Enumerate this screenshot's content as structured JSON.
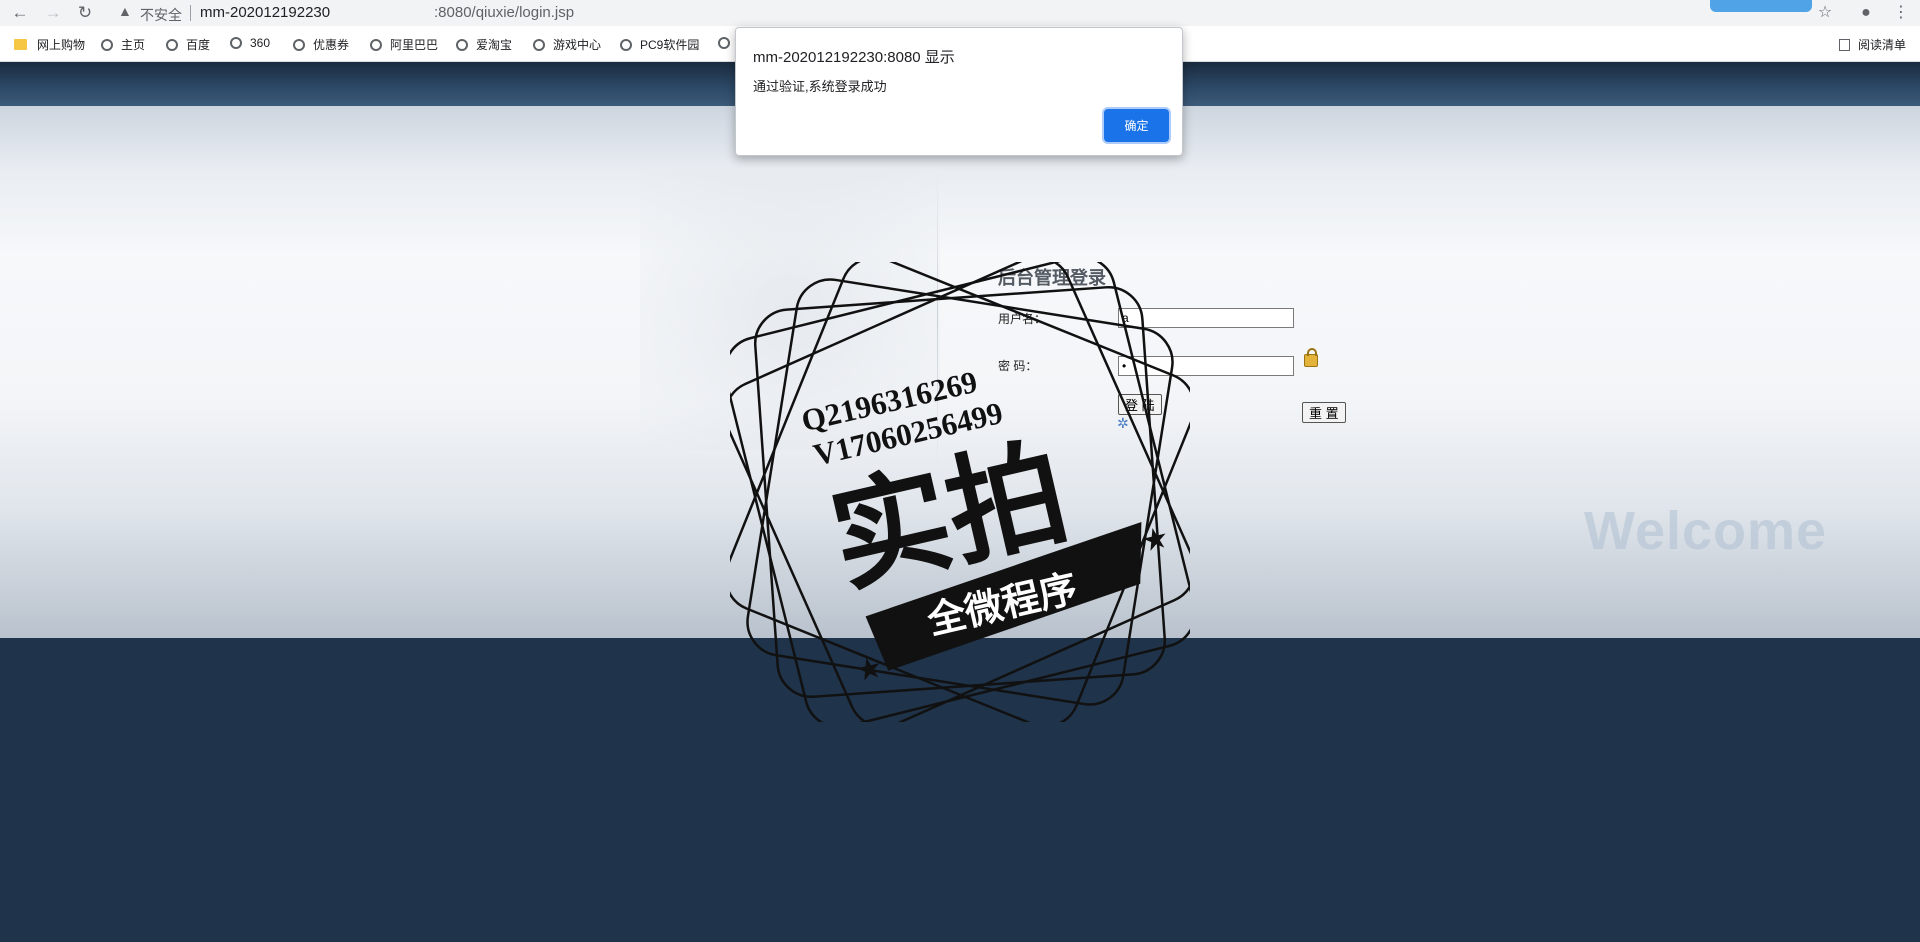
{
  "browser": {
    "security_label": "不安全",
    "url_host": "mm-202012192230",
    "url_path": ":8080/qiuxie/login.jsp",
    "bookmarks": [
      "网上购物",
      "主页",
      "百度",
      "360",
      "优惠券",
      "阿里巴巴",
      "爱淘宝",
      "游戏中心",
      "PC9软件园"
    ],
    "reading_list": "阅读清单"
  },
  "alert": {
    "title": "mm-202012192230:8080 显示",
    "message": "通过验证,系统登录成功",
    "ok_label": "确定"
  },
  "login": {
    "title": "后台管理登录",
    "username_label": "用户名：",
    "username_value": "a",
    "password_label": "密 码：",
    "password_value": "•",
    "login_button": "登 陆",
    "reset_button": "重 置",
    "welcome_text": "Welcome"
  },
  "watermark": {
    "contact_q": "Q2196316269",
    "contact_v": "V17060256499",
    "big_text": "实拍",
    "ribbon_text": "全微程序"
  },
  "colors": {
    "header_bg": "#1f334a",
    "alert_button": "#1a73e8"
  }
}
